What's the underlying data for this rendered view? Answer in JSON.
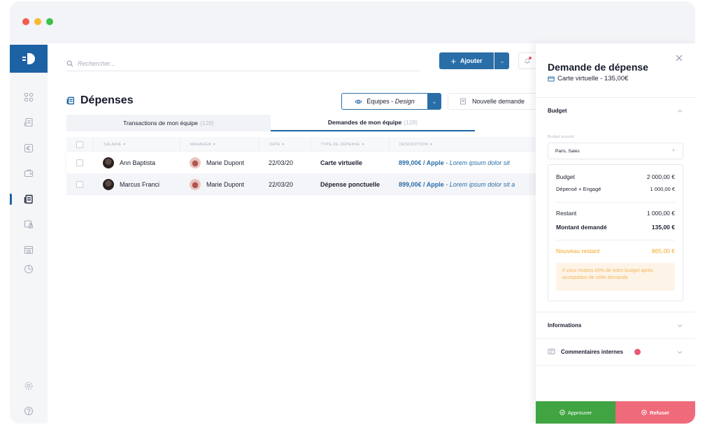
{
  "search": {
    "placeholder": "Rechercher..."
  },
  "toolbar": {
    "add_label": "Ajouter",
    "add_plus": "+"
  },
  "page": {
    "title": "Dépenses"
  },
  "filter": {
    "prefix": "Équipes - ",
    "value": "Design"
  },
  "new_request": {
    "label": "Nouvelle demande"
  },
  "tabs": [
    {
      "label": "Transactions de mon équipe",
      "count": "(128)"
    },
    {
      "label": "Demandes de mon équipe",
      "count": "(128)"
    }
  ],
  "table": {
    "columns": [
      "SALARIÉ",
      "MANAGER",
      "DATE",
      "TYPE DE DÉPENSE",
      "DESCRIPTION"
    ],
    "sort_glyph": "▾",
    "rows": [
      {
        "employee": "Ann Baptista",
        "manager": "Marie Dupont",
        "date": "22/03/20",
        "type": "Carte virtuelle",
        "amount": "899,00€ / Apple",
        "desc": " - Lorem ipsum dolor sit"
      },
      {
        "employee": "Marcus Franci",
        "manager": "Marie Dupont",
        "date": "22/03/20",
        "type": "Dépense ponctuelle",
        "amount": "899,00€ / Apple",
        "desc": " - Lorem ipsum dolor sit a"
      }
    ]
  },
  "panel": {
    "title": "Demande de dépense",
    "subtitle": "Carte virtuelle - 135,00€",
    "budget_section": "Budget",
    "assoc_label": "Budget associé",
    "assoc_value": "Paris, Sales",
    "budget": {
      "budget_label": "Budget",
      "budget_value": "2 000,00 €",
      "spent_label": "Dépensé + Engagé",
      "spent_value": "1 000,00 €",
      "remaining_label": "Restant",
      "remaining_value": "1 000,00 €",
      "requested_label": "Montant demandé",
      "requested_value": "135,00 €",
      "new_remaining_label": "Nouveau restant",
      "new_remaining_value": "865,00 €",
      "warning": "Il vous restera 43% de votre budget après acceptation de cette demande"
    },
    "informations": "Informations",
    "comments": "Commentaires internes",
    "approve": "Approuver",
    "refuse": "Refuser"
  },
  "colors": {
    "primary": "#2a6ea8",
    "approve": "#41a442",
    "refuse": "#ef6b7b",
    "warning": "#f5a623"
  }
}
